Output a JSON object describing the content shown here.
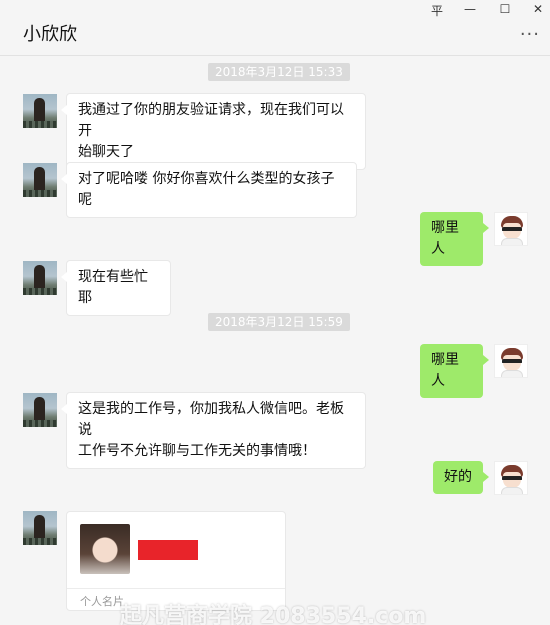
{
  "window": {
    "title": "小欣欣",
    "controls": {
      "pin": "平",
      "minimize": "—",
      "maximize": "☐",
      "close": "✕"
    },
    "more": "···"
  },
  "timestamps": [
    "2018年3月12日 15:33",
    "2018年3月12日 15:59"
  ],
  "messages": [
    {
      "side": "left",
      "lines": [
        "我通过了你的朋友验证请求，现在我们可以开",
        "始聊天了"
      ]
    },
    {
      "side": "left",
      "lines": [
        "对了呢哈喽 你好你喜欢什么类型的女孩子呢"
      ]
    },
    {
      "side": "right",
      "lines": [
        "哪里人"
      ]
    },
    {
      "side": "left",
      "lines": [
        "现在有些忙耶"
      ]
    },
    {
      "side": "right",
      "lines": [
        "哪里人"
      ]
    },
    {
      "side": "left",
      "lines": [
        "这是我的工作号，你加我私人微信吧。老板说",
        "工作号不允许聊与工作无关的事情哦！"
      ]
    },
    {
      "side": "right",
      "lines": [
        "好的"
      ]
    }
  ],
  "card": {
    "label": "个人名片"
  },
  "watermark": "起凡营商学院 2083554.com",
  "colors": {
    "accent_green": "#9eea6a",
    "background": "#f5f5f5",
    "redact": "#e8242a"
  }
}
